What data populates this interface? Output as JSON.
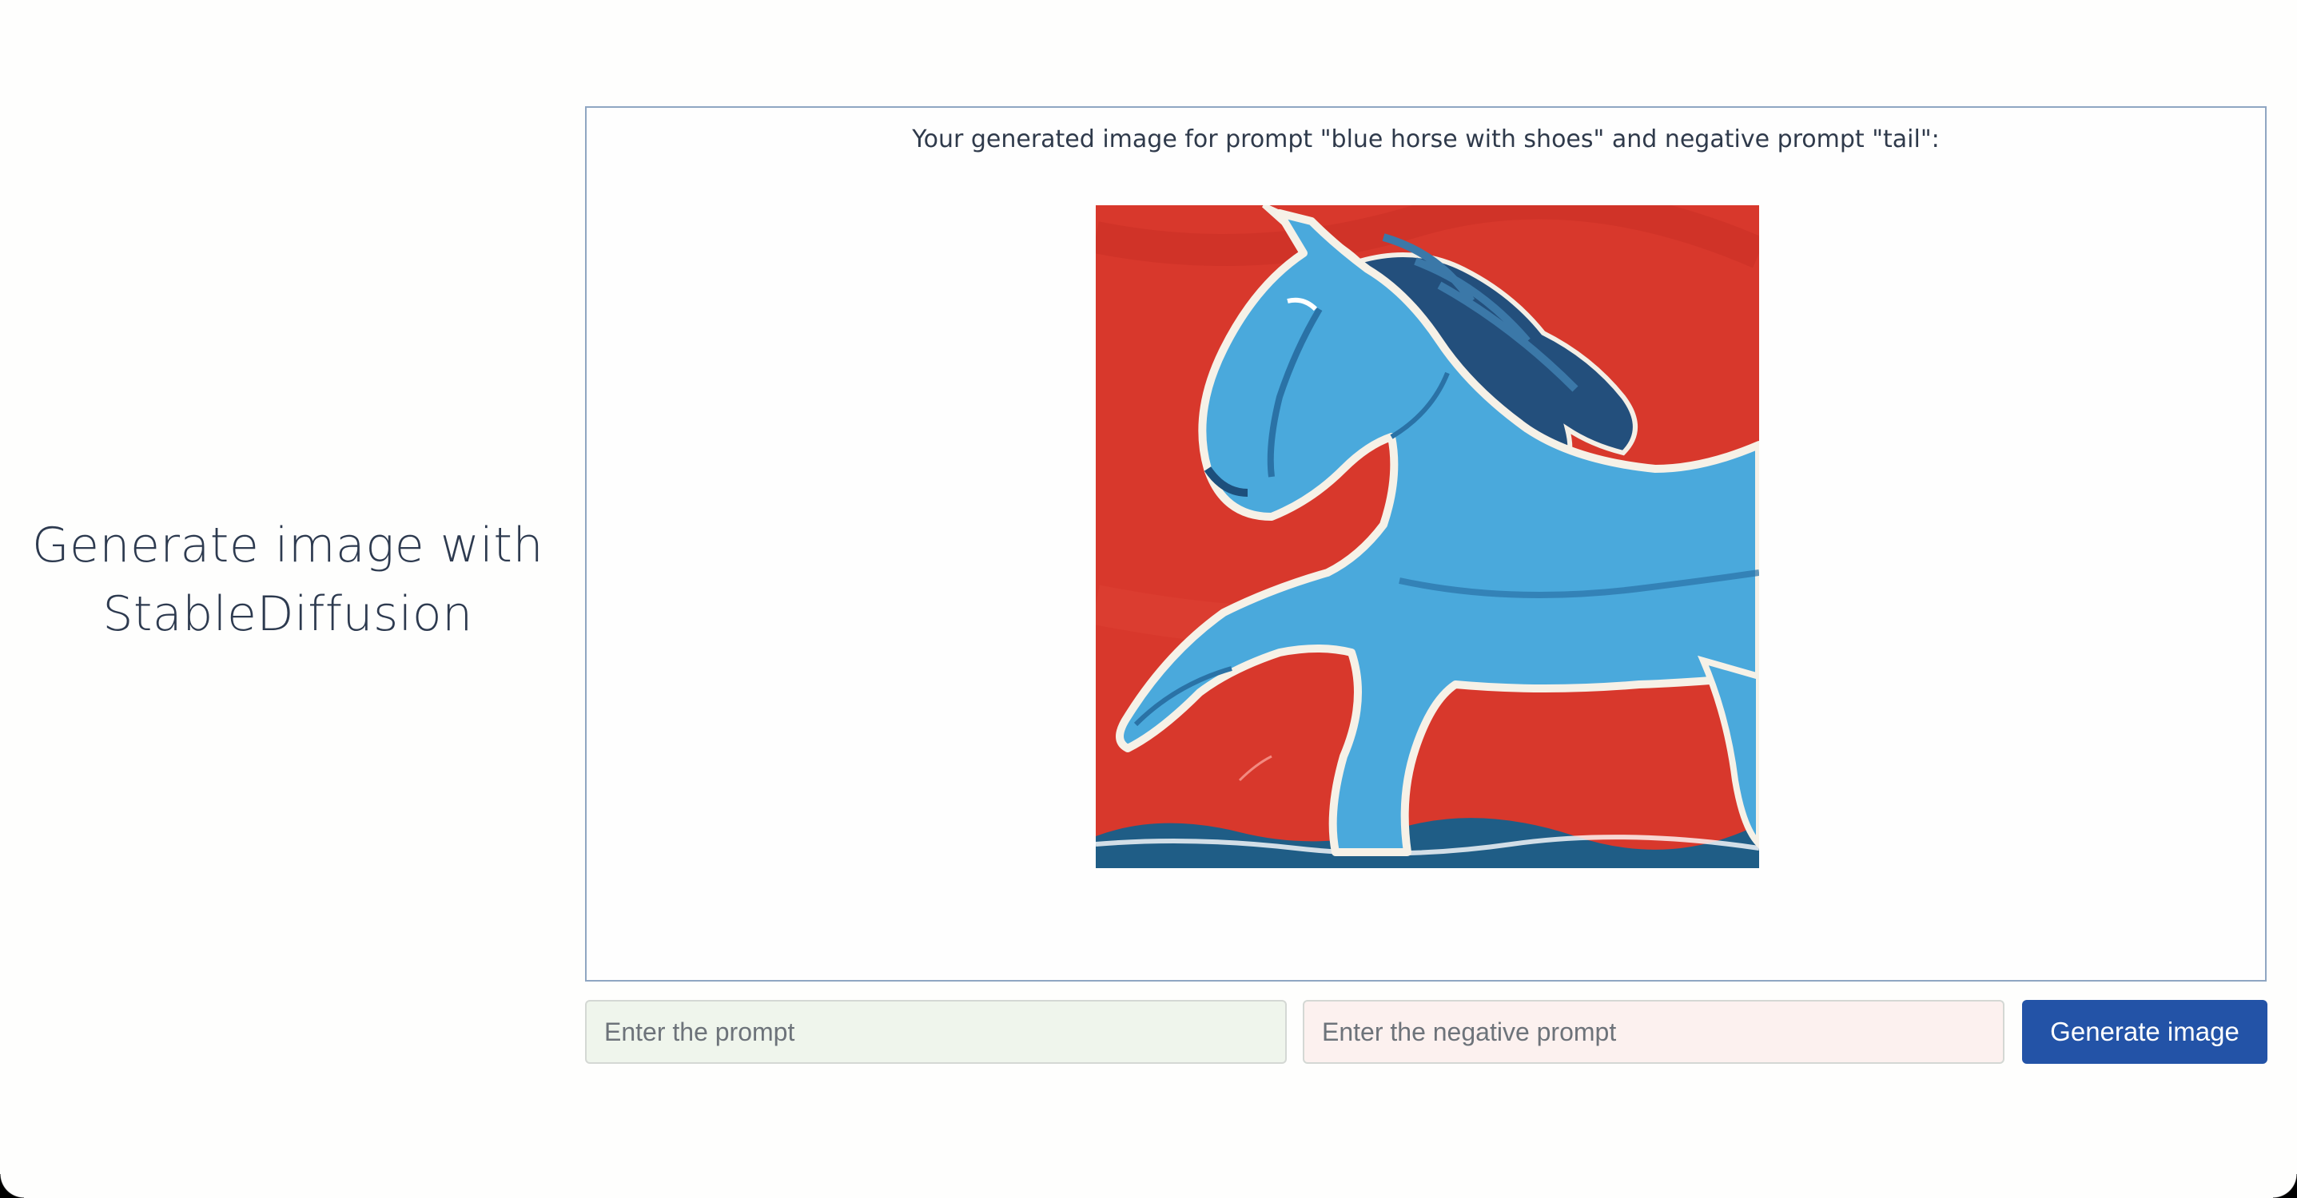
{
  "heading": {
    "line1": "Generate image with",
    "line2": "StableDiffusion"
  },
  "result": {
    "caption": "Your generated image for prompt \"blue horse with shoes\" and negative prompt \"tail\":",
    "image_subject": "blue horse painting on red background"
  },
  "form": {
    "prompt_placeholder": "Enter the prompt",
    "prompt_value": "",
    "negative_placeholder": "Enter the negative prompt",
    "negative_value": "",
    "generate_label": "Generate image"
  },
  "colors": {
    "heading_text": "#2d3a4f",
    "button_bg": "#2353a7",
    "prompt_bg": "#eff5ec",
    "negative_bg": "#fcf1ef",
    "box_border": "#8fa6c2"
  }
}
